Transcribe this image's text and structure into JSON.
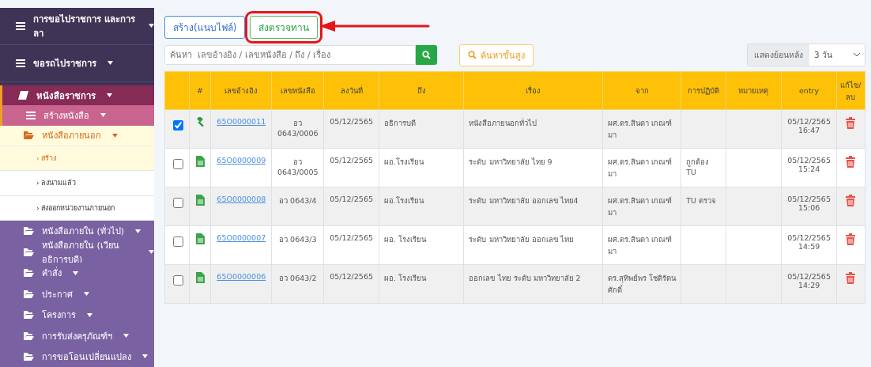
{
  "sidebar": {
    "items": [
      {
        "label": "การขอไปราชการ และการลา",
        "kind": "header",
        "expanded": false
      },
      {
        "label": "ขอรถไปราชการ",
        "kind": "header",
        "expanded": false
      },
      {
        "label": "หนังสือราชการ",
        "kind": "section",
        "expanded": true,
        "children": [
          {
            "label": "สร้างหนังสือ",
            "kind": "group",
            "expanded": true,
            "children": [
              {
                "label": "หนังสือภายนอก",
                "kind": "folder",
                "expanded": true,
                "children": [
                  {
                    "label": "› สร้าง",
                    "kind": "link",
                    "selected": true
                  },
                  {
                    "label": "› ลงนามแล้ว",
                    "kind": "link",
                    "selected": false
                  },
                  {
                    "label": "› ส่งออกหน่วยงานภายนอก",
                    "kind": "link",
                    "selected": false
                  }
                ]
              },
              {
                "label": "หนังสือภายใน (ทั่วไป)",
                "kind": "folder",
                "expanded": false
              },
              {
                "label": "หนังสือภายใน (เวียนอธิการบดี)",
                "kind": "folder",
                "expanded": false
              },
              {
                "label": "คำสั่ง",
                "kind": "folder",
                "expanded": false
              },
              {
                "label": "ประกาศ",
                "kind": "folder",
                "expanded": false
              },
              {
                "label": "โครงการ",
                "kind": "folder",
                "expanded": false
              },
              {
                "label": "การรับส่งครุภัณฑ์ฯ",
                "kind": "folder",
                "expanded": false
              },
              {
                "label": "การขอโอนเปลี่ยนแปลง",
                "kind": "folder",
                "expanded": false
              }
            ]
          }
        ]
      }
    ]
  },
  "tabs": [
    {
      "label": "สร้าง(แนบไฟล์)",
      "selected": false,
      "highlighted": false
    },
    {
      "label": "ส่งตรวจทาน",
      "selected": true,
      "highlighted": true
    }
  ],
  "search": {
    "placeholder": "ค้นหา  เลขอ้างอิง / เลขหนังสือ / ถึง / เรื่อง"
  },
  "advanced_search": {
    "label": "ค้นหาขั้นสูง"
  },
  "lookback": {
    "label": "แสดงย้อนหลัง",
    "value": "3 วัน"
  },
  "table": {
    "columns": [
      "#",
      "เลขอ้างอิง",
      "เลขหนังสือ",
      "ลงวันที่",
      "ถึง",
      "เรื่อง",
      "จาก",
      "การปฏิบัติ",
      "หมายเหตุ",
      "entry",
      "แก้ไข/ลบ"
    ],
    "rows": [
      {
        "checked": true,
        "kind": "gavel",
        "ref": "65O0000011",
        "doc_no": "อว 0643/0006",
        "date": "05/12/2565",
        "to": "อธิการบดี",
        "subject": "หนังสือภายนอกทั่วไป",
        "from": "ผศ.ดร.สินดา เกณฑ์มา",
        "action": "",
        "note": "",
        "entry": "05/12/2565 16:47"
      },
      {
        "checked": false,
        "kind": "document",
        "ref": "65O0000009",
        "doc_no": "อว 0643/0005",
        "date": "05/12/2565",
        "to": "ผอ.โรงเรียน",
        "subject": "ระดับ มหาวิทยาลัย ไทย 9",
        "from": "ผศ.ดร.สินดา เกณฑ์มา",
        "action": "ถูกต้อง TU",
        "note": "",
        "entry": "05/12/2565 15:24"
      },
      {
        "checked": false,
        "kind": "document",
        "ref": "65O0000008",
        "doc_no": "อว 0643/4",
        "date": "05/12/2565",
        "to": "ผอ.โรงเรียน",
        "subject": "ระดับ มหาวิทยาลัย ออกเลข ไทย4",
        "from": "ผศ.ดร.สินดา เกณฑ์มา",
        "action": "TU ตรวจ",
        "note": "",
        "entry": "05/12/2565 15:06"
      },
      {
        "checked": false,
        "kind": "document",
        "ref": "65O0000007",
        "doc_no": "อว 0643/3",
        "date": "05/12/2565",
        "to": "ผอ. โรงเรียน",
        "subject": "ระดับ มหาวิทยาลัย ออกเลข ไทย",
        "from": "ผศ.ดร.สินดา เกณฑ์มา",
        "action": "",
        "note": "",
        "entry": "05/12/2565 14:59"
      },
      {
        "checked": false,
        "kind": "document",
        "ref": "65O0000006",
        "doc_no": "อว 0643/2",
        "date": "05/12/2565",
        "to": "ผอ. โรงเรียน",
        "subject": "ออกเลข ไทย ระดับ มหาวิทยาลัย 2",
        "from": "ดร.สุทิพย์พร โชติรัตนศักดิ์",
        "action": "",
        "note": "",
        "entry": "05/12/2565 14:29"
      }
    ]
  }
}
